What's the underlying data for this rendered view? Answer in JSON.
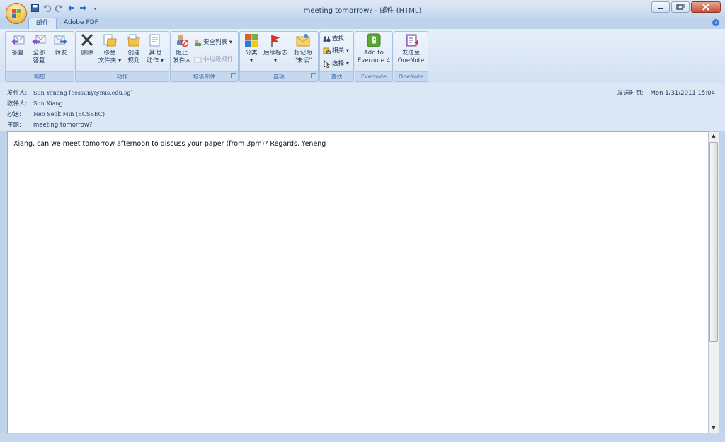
{
  "window": {
    "title": "meeting tomorrow? - 邮件 (HTML)"
  },
  "tabs": [
    {
      "label": "邮件",
      "active": true
    },
    {
      "label": "Adobe PDF",
      "active": false
    }
  ],
  "ribbon": {
    "groups": {
      "respond": {
        "label": "响应",
        "reply": "答复",
        "reply_all_1": "全部",
        "reply_all_2": "答复",
        "forward": "转发"
      },
      "actions": {
        "label": "动作",
        "delete": "删除",
        "move_1": "移至",
        "move_2": "文件夹 ▾",
        "rule_1": "创建",
        "rule_2": "规则",
        "other_1": "其他",
        "other_2": "动作 ▾"
      },
      "junk": {
        "label": "垃圾邮件",
        "block_1": "阻止",
        "block_2": "发件人",
        "safe_lists": "安全列表 ▾",
        "not_junk": "非垃圾邮件"
      },
      "options": {
        "label": "选项",
        "categorize": "分类",
        "categorize_arrow": "▾",
        "follow_up": "后续标志",
        "follow_up_arrow": "▾",
        "mark_unread_1": "标记为",
        "mark_unread_2": "\"未读\""
      },
      "find": {
        "label": "查找",
        "find": "查找",
        "related": "相关 ▾",
        "select": "选择 ▾"
      },
      "evernote": {
        "label": "Evernote",
        "add_1": "Add to",
        "add_2": "Evernote 4"
      },
      "onenote": {
        "label": "OneNote",
        "send_1": "发送至",
        "send_2": "OneNote"
      }
    }
  },
  "header": {
    "from_label": "发件人:",
    "from_value": "Sun Yeneng [ecssuny@nus.edu.sg]",
    "to_label": "收件人:",
    "to_value": "Sun Xiang",
    "cc_label": "抄送:",
    "cc_value": "Neo Seok Min (ECSSEC)",
    "subject_label": "主题:",
    "subject_value": "meeting tomorrow?",
    "sent_label": "发送时间:",
    "sent_value": "Mon 1/31/2011 15:04"
  },
  "body": {
    "text": "Xiang, can we meet tomorrow afternoon to discuss your paper (from 3pm)? Regards, Yeneng"
  }
}
